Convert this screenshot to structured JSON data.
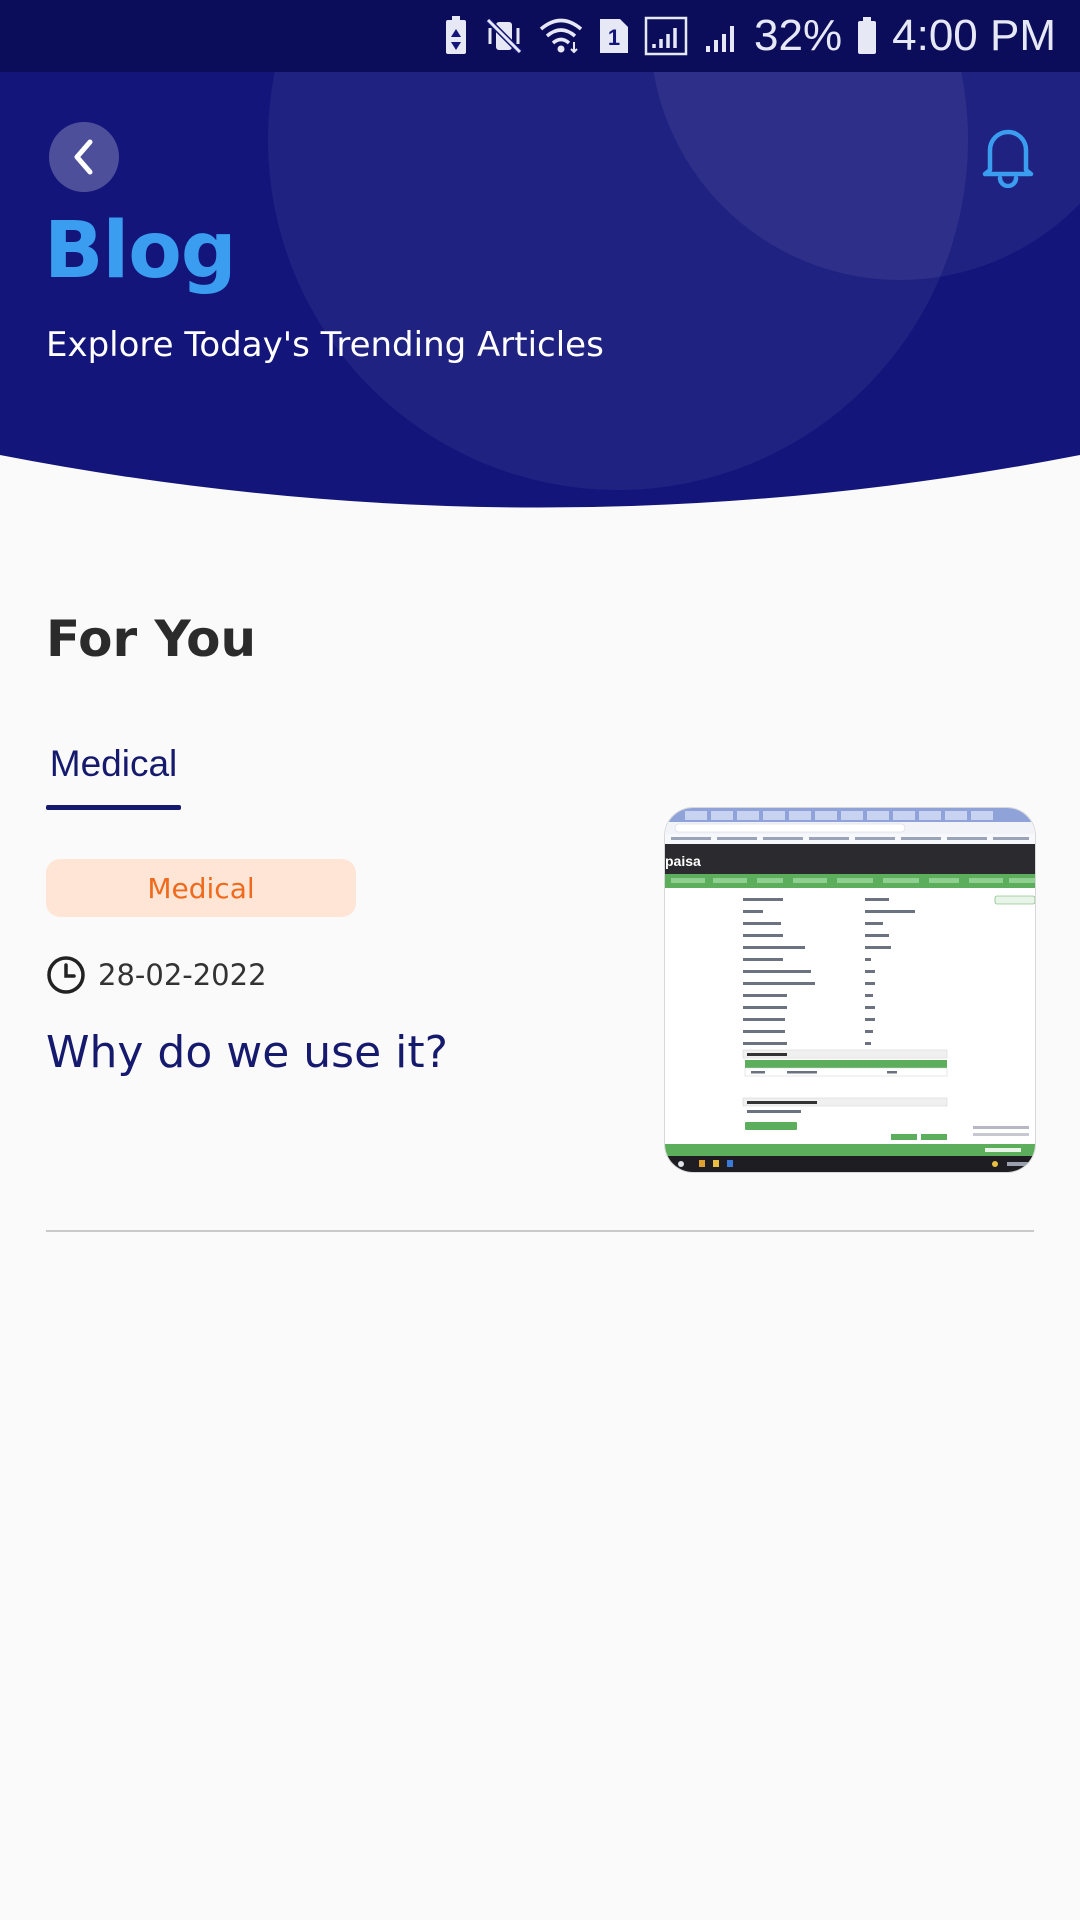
{
  "status_bar": {
    "battery_percent": "32%",
    "time": "4:00 PM",
    "sim_slot": "1",
    "icons": [
      "battery-saver-icon",
      "vibrate-mute-icon",
      "wifi-icon",
      "sim-1-icon",
      "signal-1-icon",
      "signal-2-icon",
      "battery-icon"
    ]
  },
  "header": {
    "title": "Blog",
    "subtitle": "Explore Today's Trending Articles",
    "back_icon": "back-chevron-icon",
    "notification_icon": "bell-icon",
    "colors": {
      "background": "#13157a",
      "title": "#3a9df0",
      "subtitle": "#ffffff"
    }
  },
  "section": {
    "title": "For You",
    "tabs": [
      {
        "label": "Medical",
        "selected": true
      }
    ]
  },
  "articles": [
    {
      "category": "Medical",
      "date": "28-02-2022",
      "title": "Why do we use it?",
      "thumbnail": {
        "brand": "paisa",
        "description_icon": "screenshot-thumbnail"
      }
    }
  ],
  "colors": {
    "accent": "#161a6e",
    "chip_bg": "#ffe5d6",
    "chip_text": "#ef6a1c",
    "page_bg": "#fafafa"
  }
}
